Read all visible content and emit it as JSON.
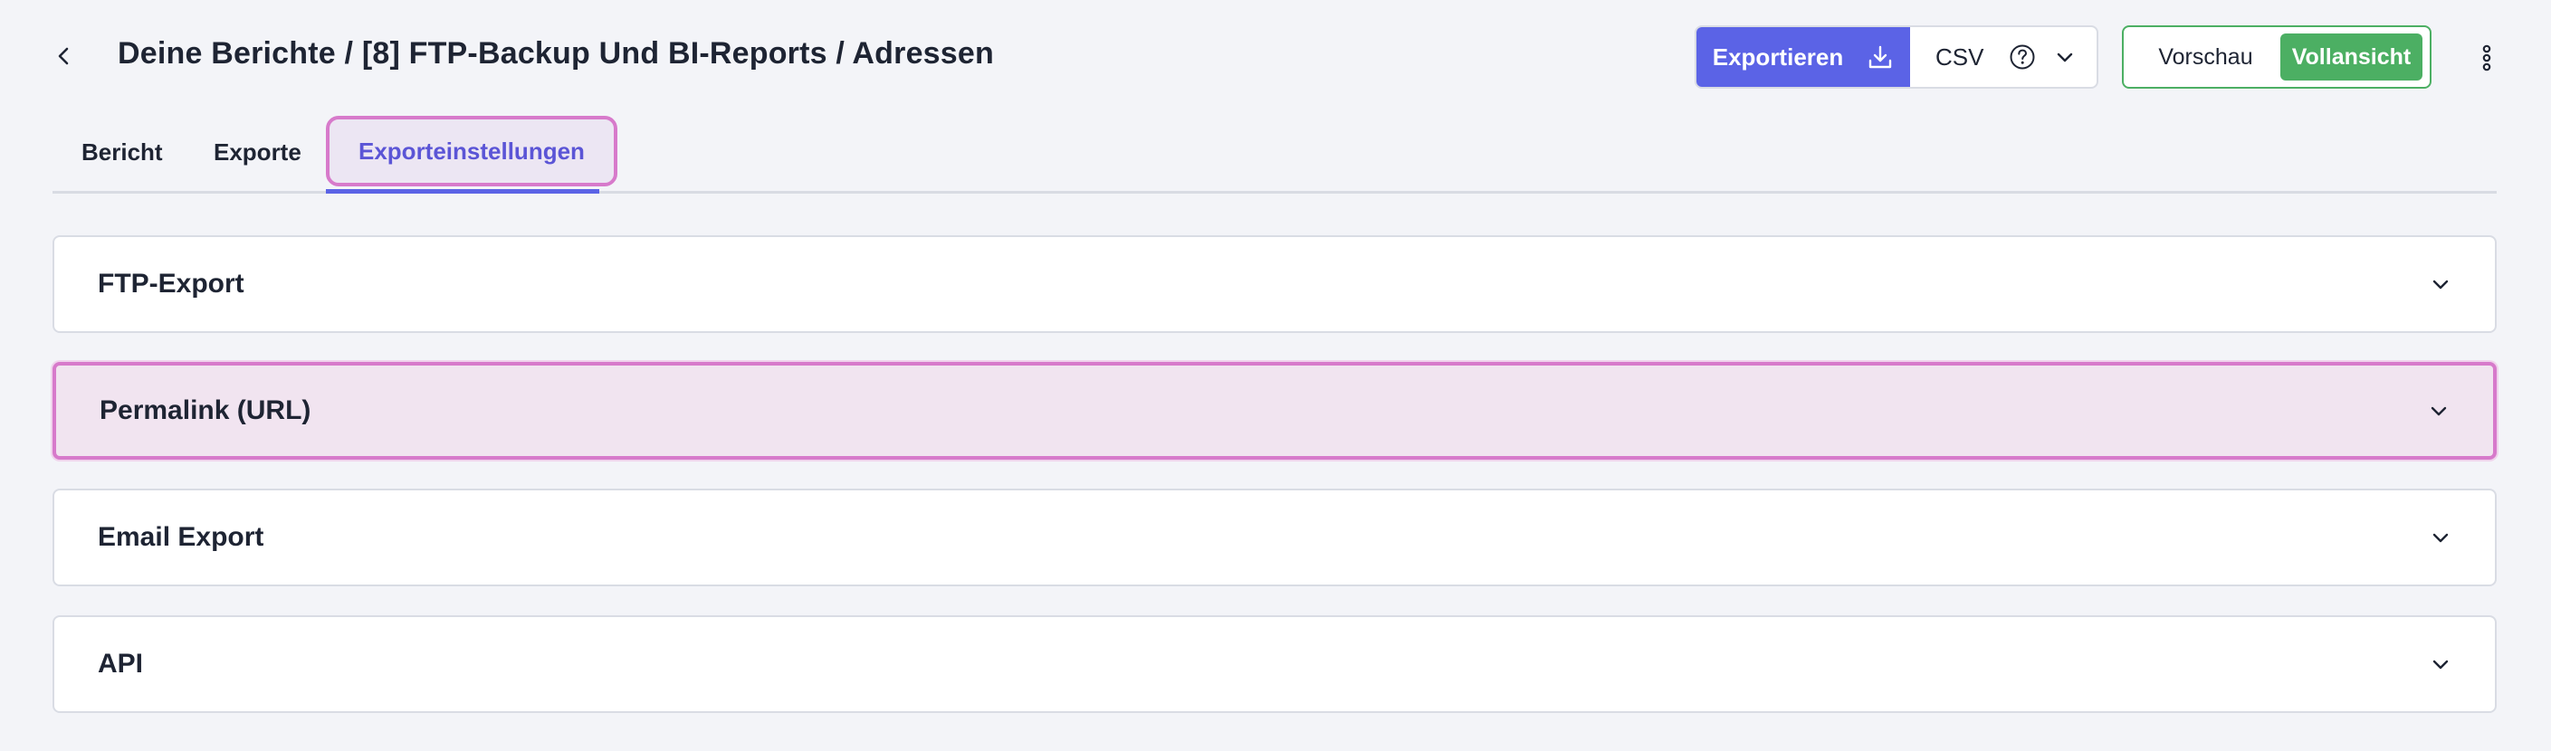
{
  "header": {
    "title": "Deine Berichte / [8] FTP-Backup Und BI-Reports / Adressen",
    "export_button_label": "Exportieren",
    "format_value": "CSV",
    "view_toggle": {
      "preview_label": "Vorschau",
      "full_label": "Vollansicht",
      "selected": "Vollansicht"
    }
  },
  "tabs": [
    {
      "label": "Bericht"
    },
    {
      "label": "Exporte"
    },
    {
      "label": "Exporteinstellungen",
      "active": true
    }
  ],
  "panels": [
    {
      "title": "FTP-Export"
    },
    {
      "title": "Permalink (URL)",
      "highlighted": true
    },
    {
      "title": "Email Export"
    },
    {
      "title": "API"
    }
  ],
  "colors": {
    "accent": "#5b63e6",
    "success": "#4caf63",
    "highlight_border": "#d77acb",
    "highlight_bg": "#f1e4f0",
    "background": "#f3f4f8"
  },
  "icons": {
    "back": "chevron-left-icon",
    "export": "download-icon",
    "help": "question-circle-icon",
    "dropdown": "chevron-down-icon",
    "more": "kebab-menu-icon",
    "panel_toggle": "chevron-down-icon"
  }
}
